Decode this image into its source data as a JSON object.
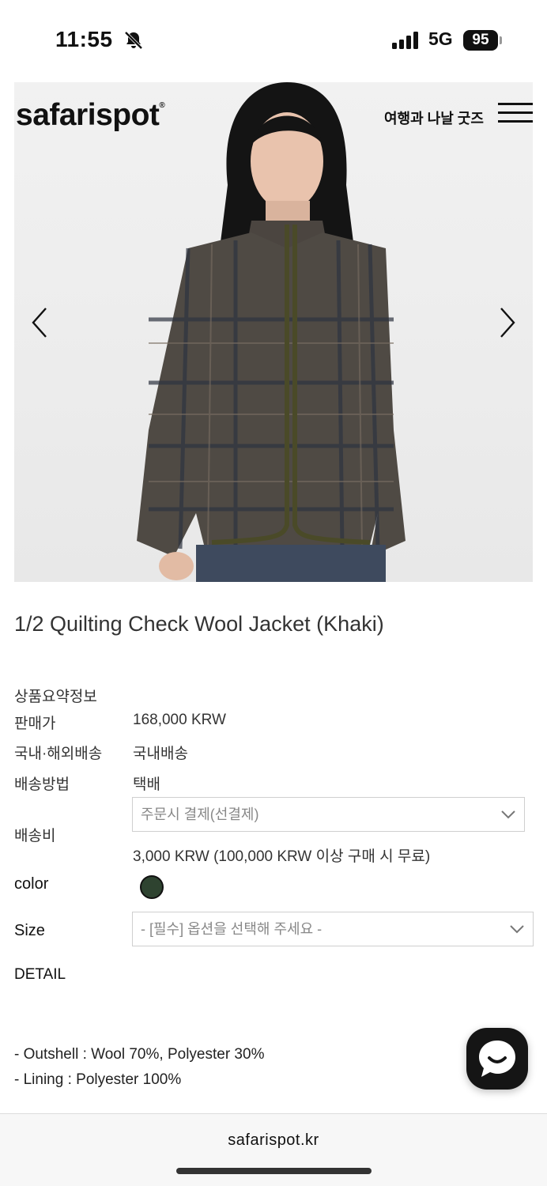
{
  "status_bar": {
    "time": "11:55",
    "network": "5G",
    "battery": "95",
    "icons": [
      "bell-muted-icon",
      "signal-icon"
    ]
  },
  "header": {
    "logo": "safarispot",
    "nav_link": "여행과 나날 굿즈",
    "icons": [
      "menu-icon",
      "chevron-left-icon",
      "chevron-right-icon"
    ]
  },
  "product": {
    "title": "1/2 Quilting Check Wool Jacket (Khaki)",
    "summary_label": "상품요약정보",
    "price_label": "판매가",
    "price_value": "168,000 KRW",
    "shipping_scope_label": "국내·해외배송",
    "shipping_scope_value": "국내배송",
    "shipping_method_label": "배송방법",
    "shipping_method_value": "택배",
    "shipping_fee_label": "배송비",
    "shipping_fee_select": "주문시 결제(선결제)",
    "shipping_fee_note": "3,000 KRW (100,000 KRW 이상 구매 시 무료)",
    "color_label": "color",
    "color_swatch": "#2e4330",
    "size_label": "Size",
    "size_select": "- [필수] 옵션을 선택해 주세요 -",
    "detail_label": "DETAIL",
    "detail_lines": [
      "- Outshell : Wool 70%, Polyester 30%",
      "- Lining : Polyester 100%"
    ]
  },
  "footer": {
    "url": "safarispot.kr"
  }
}
